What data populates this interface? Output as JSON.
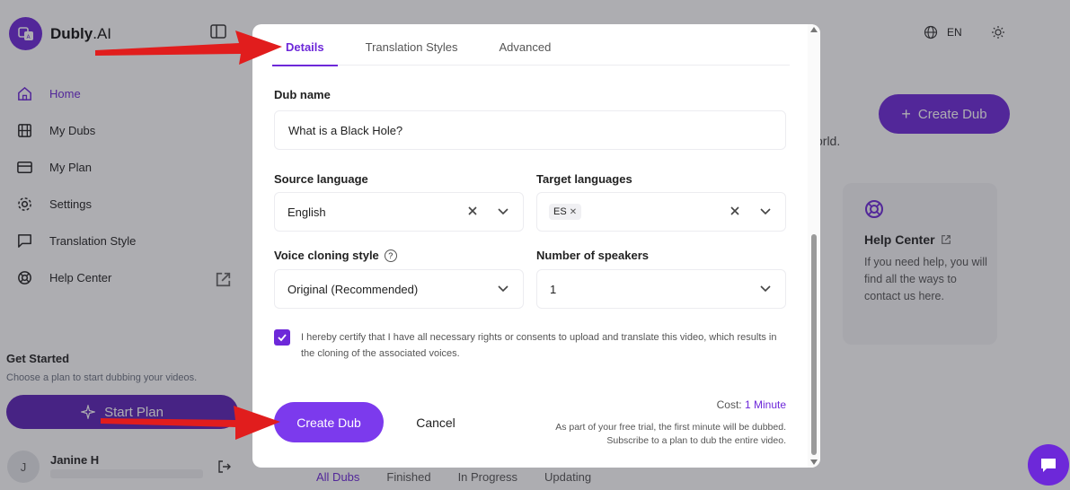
{
  "brand": {
    "name_bold": "Dubly",
    "name_rest": ".AI"
  },
  "sidebar": {
    "items": [
      {
        "label": "Home",
        "icon": "home-icon",
        "active": true
      },
      {
        "label": "My Dubs",
        "icon": "film-icon"
      },
      {
        "label": "My Plan",
        "icon": "credit-card-icon"
      },
      {
        "label": "Settings",
        "icon": "gear-icon"
      },
      {
        "label": "Translation Style",
        "icon": "message-square-icon"
      },
      {
        "label": "Help Center",
        "icon": "lifebuoy-icon",
        "external": true
      }
    ],
    "get_started_title": "Get Started",
    "get_started_sub": "Choose a plan to start dubbing your videos.",
    "start_plan_label": "Start Plan",
    "user": {
      "initial": "J",
      "name": "Janine H"
    }
  },
  "topbar": {
    "language": "EN"
  },
  "main": {
    "create_dub_label": "Create Dub",
    "world_text": "orld.",
    "help_card": {
      "title": "Help Center",
      "text": "If you need help, you will find all the ways to contact us here."
    },
    "tabs": [
      "All Dubs",
      "Finished",
      "In Progress",
      "Updating"
    ]
  },
  "modal": {
    "tabs": [
      "Details",
      "Translation Styles",
      "Advanced"
    ],
    "active_tab": "Details",
    "dub_name": {
      "label": "Dub name",
      "value": "What is a Black Hole?"
    },
    "source_language": {
      "label": "Source language",
      "value": "English"
    },
    "target_languages": {
      "label": "Target languages",
      "chips": [
        "ES"
      ]
    },
    "voice_cloning": {
      "label": "Voice cloning style",
      "value": "Original (Recommended)"
    },
    "speakers": {
      "label": "Number of speakers",
      "value": "1"
    },
    "certify_text": "I hereby certify that I have all necessary rights or consents to upload and translate this video, which results in the cloning of the associated voices.",
    "certify_checked": true,
    "create_label": "Create Dub",
    "cancel_label": "Cancel",
    "cost_label": "Cost:",
    "cost_value": "1 Minute",
    "trial_note": "As part of your free trial, the first minute will be dubbed. Subscribe to a plan to dub the entire video."
  },
  "colors": {
    "accent": "#6d28d9",
    "button": "#7c3aed",
    "arrow": "#e11d1d"
  }
}
